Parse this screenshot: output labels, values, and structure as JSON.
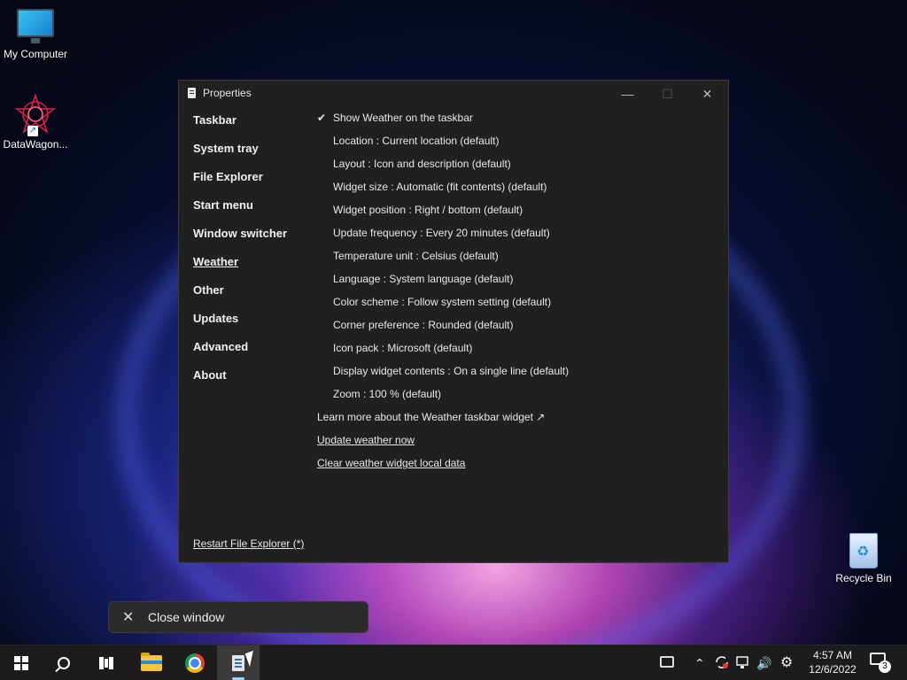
{
  "desktop": {
    "icons": [
      {
        "label": "My Computer"
      },
      {
        "label": "DataWagon..."
      },
      {
        "label": "Recycle Bin"
      }
    ]
  },
  "window": {
    "title": "Properties",
    "controls": {
      "minimize": "—",
      "maximize": "☐",
      "close": "✕"
    },
    "nav": [
      {
        "label": "Taskbar"
      },
      {
        "label": "System tray"
      },
      {
        "label": "File Explorer"
      },
      {
        "label": "Start menu"
      },
      {
        "label": "Window switcher"
      },
      {
        "label": "Weather",
        "active": true
      },
      {
        "label": "Other"
      },
      {
        "label": "Updates"
      },
      {
        "label": "Advanced"
      },
      {
        "label": "About"
      }
    ],
    "settings": [
      {
        "label": "Show Weather on the taskbar",
        "checked": true,
        "check_glyph": "✔"
      },
      {
        "label": "Location : Current location (default)"
      },
      {
        "label": "Layout : Icon and description (default)"
      },
      {
        "label": "Widget size : Automatic (fit contents) (default)"
      },
      {
        "label": "Widget position : Right / bottom (default)"
      },
      {
        "label": "Update frequency : Every 20 minutes (default)"
      },
      {
        "label": "Temperature unit : Celsius (default)"
      },
      {
        "label": "Language : System language (default)"
      },
      {
        "label": "Color scheme : Follow system setting (default)"
      },
      {
        "label": "Corner preference : Rounded (default)"
      },
      {
        "label": "Icon pack : Microsoft (default)"
      },
      {
        "label": "Display widget contents : On a single line (default)"
      },
      {
        "label": "Zoom : 100 % (default)"
      }
    ],
    "links": {
      "learn_more": "Learn more about the Weather taskbar widget ↗",
      "update_now": "Update weather now",
      "clear_data": "Clear weather widget local data",
      "restart": "Restart File Explorer (*)"
    }
  },
  "flyout": {
    "close_glyph": "✕",
    "label": "Close window"
  },
  "taskbar": {
    "apps": [
      "start",
      "search",
      "task-view",
      "file-explorer",
      "chrome",
      "properties"
    ],
    "tray": {
      "chevron": "⌃",
      "volume": "🔊",
      "settings_glyph": "⚙"
    },
    "clock": {
      "time": "4:57 AM",
      "date": "12/6/2022"
    },
    "notifications": {
      "count": "3"
    }
  },
  "colors": {
    "window_bg": "#202020",
    "taskbar_bg": "#1c1c1c",
    "active_indicator": "#9ecfff"
  }
}
